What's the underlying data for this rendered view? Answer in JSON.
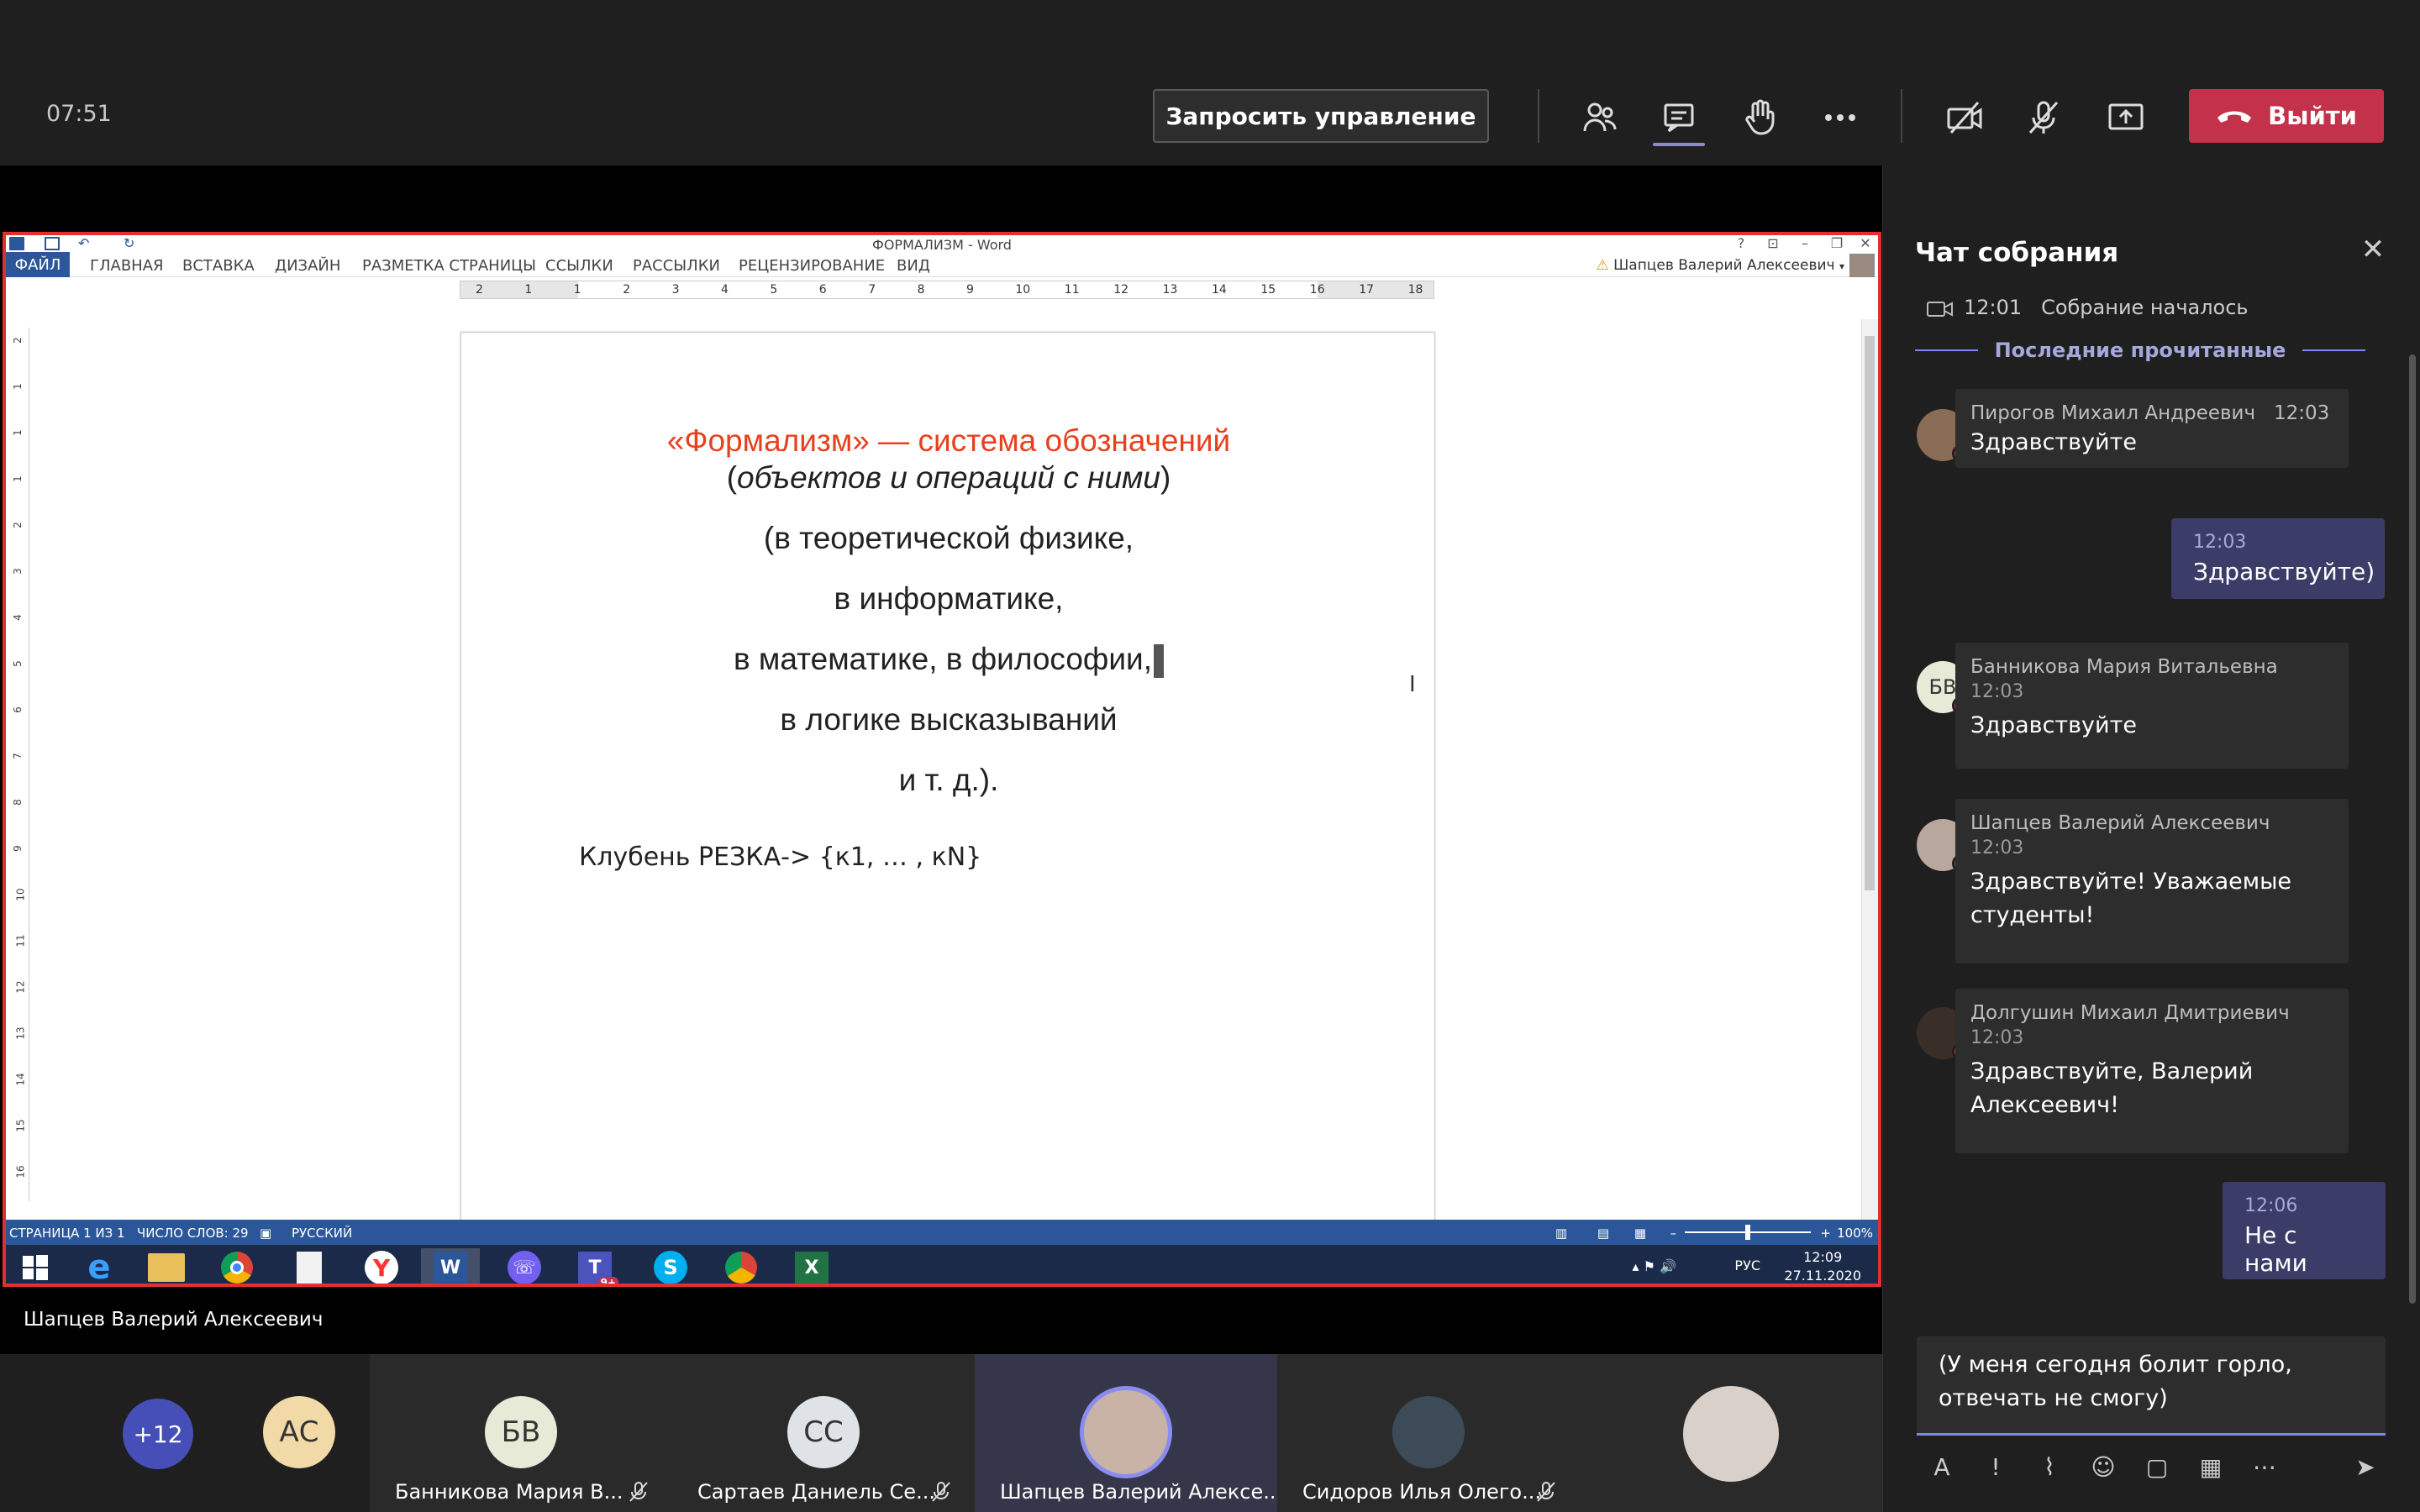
{
  "meeting": {
    "timer": "07:51",
    "request_control_label": "Запросить управление",
    "leave_label": "Выйти"
  },
  "word": {
    "title": "ФОРМАЛИЗМ - Word",
    "tabs": [
      "ФАЙЛ",
      "ГЛАВНАЯ",
      "ВСТАВКА",
      "ДИЗАЙН",
      "РАЗМЕТКА СТРАНИЦЫ",
      "ССЫЛКИ",
      "РАССЫЛКИ",
      "РЕЦЕНЗИРОВАНИЕ",
      "ВИД"
    ],
    "account_name": "Шапцев Валерий Алексеевич",
    "ruler_numbers": [
      "2",
      "1",
      "1",
      "2",
      "3",
      "4",
      "5",
      "6",
      "7",
      "8",
      "9",
      "10",
      "11",
      "12",
      "13",
      "14",
      "15",
      "16",
      "17",
      "18"
    ],
    "vruler_numbers": [
      "2",
      "1",
      "1",
      "1",
      "2",
      "3",
      "4",
      "5",
      "6",
      "7",
      "8",
      "9",
      "10",
      "11",
      "12",
      "13",
      "14",
      "15",
      "16"
    ],
    "document": {
      "heading": "«Формализм» — система обозначений",
      "subtitle_open": "(",
      "subtitle_italic": "объектов и операций с ними",
      "subtitle_close": ")",
      "line1": "(в теоретической физике,",
      "line2": "в информатике,",
      "line3": "в математике, в философии,",
      "line4": "в логике высказываний",
      "line5": "и т. д.).",
      "formula": "Клубень РЕЗКА-> {к1, … , кN}"
    },
    "status": {
      "page": "СТРАНИЦА 1 ИЗ 1",
      "words": "ЧИСЛО СЛОВ: 29",
      "language": "РУССКИЙ",
      "zoom": "100%",
      "zoom_fraction": 0.5
    }
  },
  "taskbar": {
    "apps": [
      "windows-start",
      "internet-explorer",
      "file-explorer",
      "chrome",
      "blank-file",
      "yandex-browser",
      "word",
      "viber",
      "teams",
      "skype",
      "chrome-profile",
      "excel"
    ],
    "teams_badge": "9+",
    "lang": "РУС",
    "time": "12:09",
    "date": "27.11.2020"
  },
  "presenter": "Шапцев Валерий Алексеевич",
  "participants": {
    "overflow": "+12",
    "as_initials": "АС",
    "tiles": [
      {
        "initials": "БВ",
        "name": "Банникова Мария В...",
        "avatar_color": "#e6ead7"
      },
      {
        "initials": "СС",
        "name": "Сартаев Даниель Се...",
        "avatar_color": "#dfe3e8"
      },
      {
        "initials": "",
        "name": "Шапцев Валерий Алексе...",
        "avatar_color": "#c9b3a6"
      },
      {
        "initials": "",
        "name": "Сидоров Илья Олего...",
        "avatar_color": "#3d4a58"
      },
      {
        "initials": "",
        "name": "",
        "avatar_color": "#d9d0c9"
      }
    ]
  },
  "chat": {
    "title": "Чат собрания",
    "meeting_start_time": "12:01",
    "meeting_start_text": "Собрание началось",
    "last_read": "Последние прочитанные",
    "messages": [
      {
        "author": "Пирогов Михаил Андреевич",
        "time": "12:03",
        "text": "Здравствуйте"
      },
      {
        "mine": true,
        "time": "12:03",
        "text": "Здравствуйте)"
      },
      {
        "author": "Банникова Мария Витальевна",
        "time": "12:03",
        "text": "Здравствуйте",
        "initials": "БВ"
      },
      {
        "author": "Шапцев Валерий Алексеевич",
        "time": "12:03",
        "text": "Здравствуйте! Уважаемые студенты!"
      },
      {
        "author": "Долгушин Михаил Дмитриевич",
        "time": "12:03",
        "text": "Здравствуйте, Валерий Алексеевич!"
      },
      {
        "mine": true,
        "time": "12:06",
        "text": "Не с нами"
      }
    ],
    "compose_text": "(У меня сегодня болит горло, отвечать не смогу)"
  }
}
